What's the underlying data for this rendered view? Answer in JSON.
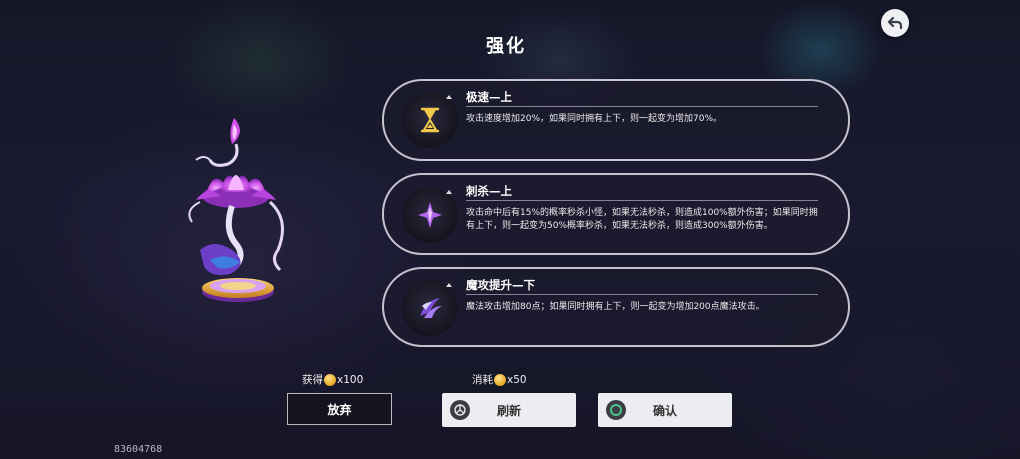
{
  "screen": {
    "title": "强化"
  },
  "options": [
    {
      "name": "极速—上",
      "icon": "hourglass-icon",
      "description": "攻击速度增加20%，如果同时拥有上下，则一起变为增加70%。"
    },
    {
      "name": "刺杀—上",
      "icon": "dagger-star-icon",
      "description": "攻击命中后有15%的概率秒杀小怪，如果无法秒杀，则造成100%额外伤害；如果同时拥有上下，则一起变为50%概率秒杀，如果无法秒杀，则造成300%额外伤害。"
    },
    {
      "name": "魔攻提升—下",
      "icon": "magic-claw-icon",
      "description": "魔法攻击增加80点；如果同时拥有上下，则一起变为增加200点魔法攻击。"
    }
  ],
  "reward": {
    "label": "获得",
    "amount": "x100",
    "icon": "coin-icon"
  },
  "cost": {
    "label": "消耗",
    "amount": "x50",
    "icon": "coin-icon"
  },
  "buttons": {
    "abandon": "放弃",
    "refresh": "刷新",
    "confirm": "确认"
  },
  "player_id": "83604768",
  "colors": {
    "panel_border": "#e6e1eb",
    "panel_bg": "#1c1a2e",
    "button_light": "#ecedf0",
    "accent_purple": "#b060f0"
  }
}
